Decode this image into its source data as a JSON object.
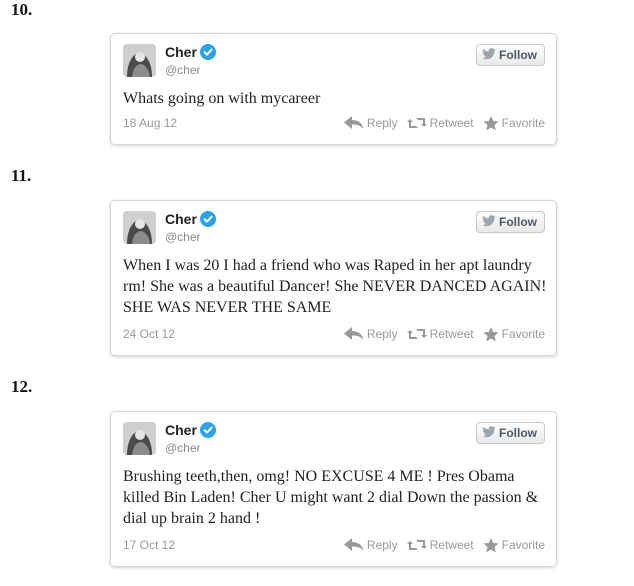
{
  "tweets": [
    {
      "number": "10.",
      "name": "Cher",
      "handle": "@cher",
      "follow_label": "Follow",
      "text": "Whats going on with mycareer",
      "date": "18 Aug 12",
      "reply_label": "Reply",
      "retweet_label": "Retweet",
      "favorite_label": "Favorite"
    },
    {
      "number": "11.",
      "name": "Cher",
      "handle": "@cher",
      "follow_label": "Follow",
      "text": "When I was 20 I had a friend who was Raped in her apt laundry rm! She was a beautiful Dancer! She NEVER DANCED AGAIN! SHE WAS NEVER THE SAME",
      "date": "24 Oct 12",
      "reply_label": "Reply",
      "retweet_label": "Retweet",
      "favorite_label": "Favorite"
    },
    {
      "number": "12.",
      "name": "Cher",
      "handle": "@cher",
      "follow_label": "Follow",
      "text": "Brushing teeth,then, omg! NO EXCUSE 4 ME ! Pres Obama killed Bin Laden! Cher U might want 2 dial Down the passion & dial up brain 2 hand !",
      "date": "17 Oct 12",
      "reply_label": "Reply",
      "retweet_label": "Retweet",
      "favorite_label": "Favorite"
    }
  ],
  "colors": {
    "verified": "#2aa3ef",
    "muted_text": "#999999",
    "follow_text": "#4d5a66",
    "card_border": "#d8d8d8"
  },
  "icons": {
    "verified": "verified-badge-icon",
    "follow": "twitter-bird-icon",
    "reply": "reply-arrow-icon",
    "retweet": "retweet-icon",
    "favorite": "star-icon"
  }
}
